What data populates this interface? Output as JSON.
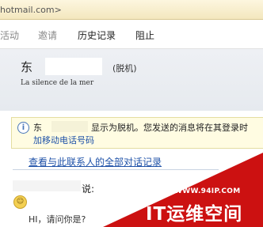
{
  "address_bar": {
    "text": "hotmail.com>"
  },
  "menu": {
    "items": [
      {
        "label": "活动"
      },
      {
        "label": "邀请"
      },
      {
        "label": "历史记录"
      },
      {
        "label": "阻止"
      }
    ]
  },
  "contact": {
    "name": "东",
    "presence": "(脱机)",
    "personal_message": "La silence de la mer"
  },
  "notice": {
    "name": "东",
    "text": "显示为脱机。您发送的消息将在其登录时",
    "link": "加移动电话号码"
  },
  "history_link": "查看与此联系人的全部对话记录",
  "conversation": {
    "said": "说:",
    "emoji": "☺",
    "message": "HI，请问你是?"
  },
  "watermark": {
    "url": "WWW.94IP.COM",
    "title": "IT运维空间",
    "color": "#cc1111"
  },
  "colors": {
    "link": "#1f52a8",
    "notice_bg": "#fffce2",
    "header_bg": "#e9ecf0"
  }
}
